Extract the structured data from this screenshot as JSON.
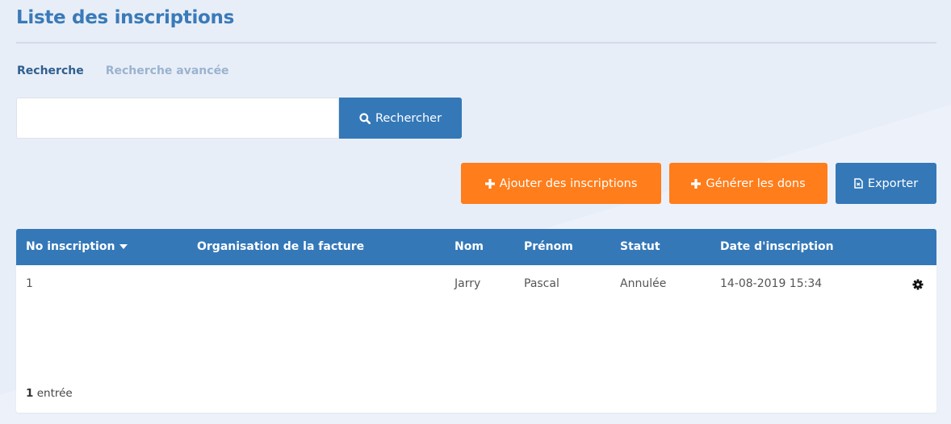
{
  "page": {
    "title": "Liste des inscriptions"
  },
  "tabs": [
    {
      "label": "Recherche",
      "active": true
    },
    {
      "label": "Recherche avancée",
      "active": false
    }
  ],
  "search": {
    "value": "",
    "placeholder": "",
    "button_label": "Rechercher",
    "button_icon": "search-icon"
  },
  "actions": {
    "add_label": "Ajouter des inscriptions",
    "generate_label": "Générer les dons",
    "export_label": "Exporter"
  },
  "table": {
    "columns": [
      "No inscription",
      "Organisation de la facture",
      "Nom",
      "Prénom",
      "Statut",
      "Date d'inscription"
    ],
    "sort_column": "No inscription",
    "rows": [
      {
        "no": "1",
        "organisation": "",
        "nom": "Jarry",
        "prenom": "Pascal",
        "statut": "Annulée",
        "date": "14-08-2019 15:34"
      }
    ]
  },
  "footer": {
    "count": "1",
    "count_label": "entrée"
  },
  "colors": {
    "primary": "#3478b8",
    "accent": "#ff7d1a",
    "title": "#3a7ab8",
    "background": "#e8eef8"
  }
}
